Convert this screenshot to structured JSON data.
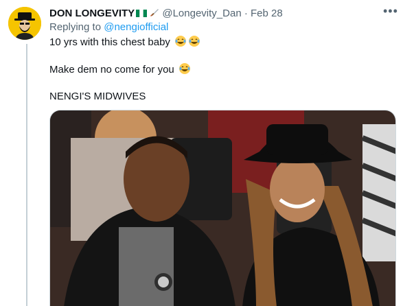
{
  "tweet": {
    "author_name": "DON LONGEVITY",
    "handle": "@Longevity_Dan",
    "separator": "·",
    "date": "Feb 28",
    "more_menu": "•••",
    "replying_to_prefix": "Replying to",
    "replying_to_handle": "@nengiofficial",
    "text_lines": [
      "10 yrs with this chest baby",
      "Make dem no come for you",
      "NENGI'S MIDWIVES"
    ],
    "icons": {
      "flag": "nigeria-flag-icon",
      "knife": "dagger-icon",
      "emoji": "face-with-tears-of-joy-icon"
    }
  },
  "colors": {
    "text": "#0f1419",
    "muted": "#536471",
    "link": "#1d9bf0",
    "thread_line": "#c4cfd6",
    "avatar_bg": "#f5c400"
  }
}
